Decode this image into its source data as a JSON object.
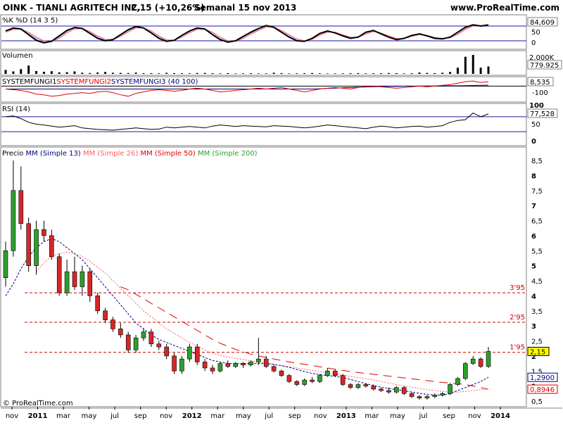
{
  "header": {
    "ticker_title": "OINK - TIANLI AGRITECH INC.",
    "price_change": "2,15 (+10,26%)",
    "period": "Semanal  15 nov 2013",
    "site": "www.ProRealTime.com"
  },
  "footer": {
    "copyright": "© ProRealTime.com"
  },
  "colors": {
    "background": "#ffffff",
    "panel_border": "#7f7f7f",
    "candle_up": "#2ca02c",
    "candle_down": "#d62728",
    "sma13": "#000080",
    "sma26": "#ff6060",
    "sma50": "#e00000",
    "hline": "#d00000",
    "reference_line": "#1a1aa0",
    "highlight_box": "#ffff00"
  },
  "x_axis": {
    "ticks": [
      "nov",
      "2011",
      "mar",
      "may",
      "jul",
      "sep",
      "nov",
      "2012",
      "mar",
      "may",
      "jul",
      "sep",
      "nov",
      "2013",
      "mar",
      "may",
      "jul",
      "sep",
      "nov",
      "2014"
    ],
    "bold_ticks": [
      "2011",
      "2012",
      "2013",
      "2014"
    ]
  },
  "chart_data": [
    {
      "type": "line",
      "name": "stochastic",
      "title": "%K %D (14 3 5)",
      "ylim": [
        0,
        100
      ],
      "y_ticks": [
        "100",
        "50",
        "0"
      ],
      "reference_levels": [
        80,
        20
      ],
      "last_value": "84,609",
      "series": [
        {
          "name": "%K",
          "values": [
            60,
            72,
            68,
            45,
            22,
            12,
            18,
            40,
            62,
            74,
            70,
            50,
            30,
            20,
            25,
            45,
            65,
            78,
            72,
            52,
            30,
            18,
            22,
            42,
            60,
            72,
            68,
            45,
            25,
            15,
            20,
            38,
            55,
            70,
            82,
            75,
            55,
            35,
            20,
            18,
            30,
            50,
            60,
            52,
            40,
            30,
            35,
            55,
            62,
            48,
            35,
            25,
            30,
            42,
            48,
            40,
            30,
            28,
            35,
            55,
            75,
            85,
            80,
            84.6
          ]
        },
        {
          "name": "%D",
          "values": [
            55,
            66,
            68,
            55,
            35,
            20,
            16,
            30,
            52,
            68,
            70,
            58,
            40,
            26,
            24,
            38,
            56,
            72,
            72,
            60,
            40,
            24,
            22,
            35,
            52,
            66,
            68,
            55,
            35,
            20,
            18,
            30,
            47,
            62,
            76,
            76,
            62,
            45,
            28,
            20,
            26,
            42,
            55,
            55,
            45,
            35,
            34,
            47,
            58,
            52,
            40,
            30,
            29,
            38,
            45,
            42,
            34,
            30,
            32,
            46,
            66,
            80,
            82,
            83
          ]
        }
      ]
    },
    {
      "type": "bar",
      "name": "volume",
      "title": "Volumen",
      "y_ticks": [
        "2.000K"
      ],
      "last_value": "779.925",
      "values": [
        420,
        260,
        500,
        880,
        300,
        220,
        280,
        160,
        180,
        260,
        120,
        90,
        140,
        200,
        120,
        100,
        90,
        130,
        80,
        70,
        60,
        110,
        80,
        70,
        60,
        90,
        100,
        70,
        60,
        80,
        50,
        60,
        70,
        55,
        60,
        120,
        80,
        50,
        60,
        70,
        90,
        60,
        50,
        55,
        60,
        70,
        80,
        60,
        65,
        70,
        90,
        80,
        60,
        70,
        140,
        100,
        80,
        120,
        200,
        650,
        1800,
        2000,
        650,
        780
      ]
    },
    {
      "type": "line",
      "name": "systemfungi",
      "title_parts": [
        "SYSTEMFUNGI1",
        "SYSTEMFUNGI2",
        "SYSTEMFUNGI3 (40 100)"
      ],
      "y_ticks": [
        "0",
        "-100"
      ],
      "last_value": "8,535",
      "series": [
        {
          "name": "SYSTEMFUNGI1",
          "values": [
            -20,
            -25,
            -30,
            -40,
            -55,
            -60,
            -70,
            -65,
            -55,
            -50,
            -45,
            -50,
            -40,
            -35,
            -45,
            -60,
            -70,
            -50,
            -40,
            -30,
            -25,
            -30,
            -35,
            -30,
            -20,
            -15,
            -20,
            -30,
            -40,
            -35,
            -30,
            -25,
            -20,
            -15,
            -20,
            -15,
            -10,
            -20,
            -30,
            -40,
            -30,
            -20,
            -15,
            -10,
            -15,
            -20,
            -10,
            -5,
            0,
            -5,
            -10,
            -15,
            -10,
            -5,
            0,
            -5,
            0,
            5,
            10,
            20,
            30,
            35,
            25,
            30
          ]
        },
        {
          "name": "SYSTEMFUNGI2",
          "values": [
            -20,
            -20,
            -20,
            -20,
            -20,
            -20,
            -20,
            -20,
            -20,
            -20,
            -20,
            -20,
            -20,
            -20,
            -20,
            -20,
            -20,
            -20,
            -20,
            -20,
            -20,
            -20,
            -20,
            -20,
            -20,
            -20,
            -20,
            -20,
            -20,
            -20,
            -20,
            -20,
            -20,
            -20,
            -20,
            -20,
            -20,
            -20,
            -20,
            -20,
            -20,
            -18,
            -16,
            -14,
            -12,
            -10,
            -8,
            -6,
            -4,
            -3,
            -2,
            -2,
            -1,
            -1,
            0,
            0,
            1,
            1,
            2,
            2,
            3,
            4,
            5,
            6
          ]
        }
      ]
    },
    {
      "type": "line",
      "name": "rsi",
      "title": "RSI (14)",
      "ylim": [
        0,
        100
      ],
      "y_ticks": [
        "100",
        "50",
        "0"
      ],
      "reference_levels": [
        70,
        30
      ],
      "last_value": "77,528",
      "values": [
        70,
        72,
        65,
        55,
        50,
        48,
        45,
        42,
        44,
        46,
        40,
        38,
        36,
        35,
        34,
        36,
        38,
        40,
        38,
        36,
        37,
        42,
        40,
        42,
        44,
        42,
        40,
        45,
        48,
        46,
        44,
        46,
        45,
        44,
        43,
        46,
        45,
        44,
        42,
        40,
        42,
        45,
        48,
        46,
        44,
        42,
        40,
        38,
        42,
        45,
        43,
        40,
        42,
        44,
        45,
        42,
        44,
        46,
        55,
        60,
        62,
        80,
        70,
        77.5
      ]
    },
    {
      "type": "bar",
      "name": "price",
      "title_parts": [
        "Precio",
        "MM (Simple 13)",
        "MM (Simple 26)",
        "MM (Simple 50)",
        "MM (Simple 200)"
      ],
      "ylim": [
        0.3,
        8.8
      ],
      "y_ticks": [
        "8,5",
        "8",
        "7,5",
        "7",
        "6,5",
        "6",
        "5,5",
        "5",
        "4,5",
        "4",
        "3,5",
        "3",
        "2,5",
        "2",
        "1,5",
        "1",
        "0,5"
      ],
      "y_values": [
        8.5,
        8,
        7.5,
        7,
        6.5,
        6,
        5.5,
        5,
        4.5,
        4,
        3.5,
        3,
        2.5,
        2,
        1.5,
        1,
        0.5
      ],
      "horizontal_levels": [
        {
          "value": 4.1,
          "label": "3'95"
        },
        {
          "value": 3.12,
          "label": "2'95"
        },
        {
          "value": 2.12,
          "label": "1'95"
        }
      ],
      "value_tags": [
        {
          "value": 2.15,
          "label": "2,15"
        },
        {
          "value": 1.29,
          "label": "1,2900"
        },
        {
          "value": 0.8946,
          "label": "0,8946"
        }
      ],
      "candles": [
        {
          "o": 4.6,
          "h": 5.8,
          "l": 4.3,
          "c": 5.5
        },
        {
          "o": 5.5,
          "h": 8.5,
          "l": 5.3,
          "c": 7.5
        },
        {
          "o": 7.5,
          "h": 8.3,
          "l": 6.2,
          "c": 6.4
        },
        {
          "o": 6.4,
          "h": 6.6,
          "l": 4.8,
          "c": 5.0
        },
        {
          "o": 5.0,
          "h": 6.5,
          "l": 4.7,
          "c": 6.2
        },
        {
          "o": 6.2,
          "h": 6.5,
          "l": 5.8,
          "c": 6.0
        },
        {
          "o": 6.0,
          "h": 6.2,
          "l": 5.2,
          "c": 5.3
        },
        {
          "o": 5.3,
          "h": 5.4,
          "l": 4.0,
          "c": 4.1
        },
        {
          "o": 4.1,
          "h": 5.2,
          "l": 4.0,
          "c": 4.8
        },
        {
          "o": 4.8,
          "h": 5.3,
          "l": 4.2,
          "c": 4.3
        },
        {
          "o": 4.3,
          "h": 5.0,
          "l": 4.0,
          "c": 4.8
        },
        {
          "o": 4.8,
          "h": 4.9,
          "l": 3.8,
          "c": 4.0
        },
        {
          "o": 4.0,
          "h": 4.1,
          "l": 3.4,
          "c": 3.5
        },
        {
          "o": 3.5,
          "h": 3.6,
          "l": 3.1,
          "c": 3.2
        },
        {
          "o": 3.2,
          "h": 3.3,
          "l": 2.8,
          "c": 2.9
        },
        {
          "o": 2.9,
          "h": 3.1,
          "l": 2.6,
          "c": 2.7
        },
        {
          "o": 2.7,
          "h": 2.8,
          "l": 2.1,
          "c": 2.2
        },
        {
          "o": 2.2,
          "h": 2.7,
          "l": 2.1,
          "c": 2.6
        },
        {
          "o": 2.6,
          "h": 2.9,
          "l": 2.5,
          "c": 2.8
        },
        {
          "o": 2.8,
          "h": 2.9,
          "l": 2.3,
          "c": 2.4
        },
        {
          "o": 2.4,
          "h": 2.5,
          "l": 2.2,
          "c": 2.3
        },
        {
          "o": 2.3,
          "h": 2.4,
          "l": 1.9,
          "c": 2.0
        },
        {
          "o": 2.0,
          "h": 2.1,
          "l": 1.4,
          "c": 1.5
        },
        {
          "o": 1.5,
          "h": 2.0,
          "l": 1.4,
          "c": 1.9
        },
        {
          "o": 1.9,
          "h": 2.4,
          "l": 1.8,
          "c": 2.3
        },
        {
          "o": 2.3,
          "h": 2.4,
          "l": 1.7,
          "c": 1.8
        },
        {
          "o": 1.8,
          "h": 1.9,
          "l": 1.5,
          "c": 1.6
        },
        {
          "o": 1.6,
          "h": 1.7,
          "l": 1.4,
          "c": 1.5
        },
        {
          "o": 1.5,
          "h": 1.8,
          "l": 1.45,
          "c": 1.75
        },
        {
          "o": 1.75,
          "h": 1.85,
          "l": 1.6,
          "c": 1.65
        },
        {
          "o": 1.65,
          "h": 1.8,
          "l": 1.6,
          "c": 1.75
        },
        {
          "o": 1.75,
          "h": 1.8,
          "l": 1.6,
          "c": 1.7
        },
        {
          "o": 1.7,
          "h": 1.85,
          "l": 1.65,
          "c": 1.8
        },
        {
          "o": 1.8,
          "h": 2.6,
          "l": 1.7,
          "c": 1.9
        },
        {
          "o": 1.9,
          "h": 2.0,
          "l": 1.6,
          "c": 1.65
        },
        {
          "o": 1.65,
          "h": 1.7,
          "l": 1.45,
          "c": 1.5
        },
        {
          "o": 1.5,
          "h": 1.55,
          "l": 1.3,
          "c": 1.35
        },
        {
          "o": 1.35,
          "h": 1.4,
          "l": 1.1,
          "c": 1.15
        },
        {
          "o": 1.15,
          "h": 1.2,
          "l": 1.0,
          "c": 1.05
        },
        {
          "o": 1.05,
          "h": 1.25,
          "l": 1.0,
          "c": 1.2
        },
        {
          "o": 1.2,
          "h": 1.3,
          "l": 1.1,
          "c": 1.15
        },
        {
          "o": 1.15,
          "h": 1.4,
          "l": 1.1,
          "c": 1.35
        },
        {
          "o": 1.35,
          "h": 1.6,
          "l": 1.3,
          "c": 1.5
        },
        {
          "o": 1.5,
          "h": 1.55,
          "l": 1.3,
          "c": 1.35
        },
        {
          "o": 1.35,
          "h": 1.4,
          "l": 1.0,
          "c": 1.05
        },
        {
          "o": 1.05,
          "h": 1.1,
          "l": 0.9,
          "c": 0.95
        },
        {
          "o": 0.95,
          "h": 1.1,
          "l": 0.9,
          "c": 1.05
        },
        {
          "o": 1.05,
          "h": 1.1,
          "l": 0.95,
          "c": 1.0
        },
        {
          "o": 1.0,
          "h": 1.05,
          "l": 0.85,
          "c": 0.9
        },
        {
          "o": 0.9,
          "h": 0.95,
          "l": 0.8,
          "c": 0.85
        },
        {
          "o": 0.85,
          "h": 0.95,
          "l": 0.75,
          "c": 0.8
        },
        {
          "o": 0.8,
          "h": 1.0,
          "l": 0.75,
          "c": 0.95
        },
        {
          "o": 0.95,
          "h": 1.0,
          "l": 0.7,
          "c": 0.75
        },
        {
          "o": 0.75,
          "h": 0.8,
          "l": 0.6,
          "c": 0.65
        },
        {
          "o": 0.65,
          "h": 0.7,
          "l": 0.55,
          "c": 0.6
        },
        {
          "o": 0.6,
          "h": 0.7,
          "l": 0.55,
          "c": 0.65
        },
        {
          "o": 0.65,
          "h": 0.75,
          "l": 0.6,
          "c": 0.7
        },
        {
          "o": 0.7,
          "h": 0.8,
          "l": 0.65,
          "c": 0.75
        },
        {
          "o": 0.75,
          "h": 1.1,
          "l": 0.7,
          "c": 1.05
        },
        {
          "o": 1.05,
          "h": 1.3,
          "l": 1.0,
          "c": 1.25
        },
        {
          "o": 1.25,
          "h": 1.8,
          "l": 1.2,
          "c": 1.75
        },
        {
          "o": 1.75,
          "h": 2.0,
          "l": 1.7,
          "c": 1.9
        },
        {
          "o": 1.9,
          "h": 1.95,
          "l": 1.6,
          "c": 1.65
        },
        {
          "o": 1.65,
          "h": 2.3,
          "l": 1.6,
          "c": 2.15
        }
      ],
      "sma13_values": [
        4.0,
        4.4,
        4.9,
        5.3,
        5.6,
        5.8,
        5.9,
        5.8,
        5.6,
        5.4,
        5.2,
        4.9,
        4.6,
        4.3,
        4.0,
        3.7,
        3.4,
        3.1,
        2.9,
        2.7,
        2.55,
        2.45,
        2.35,
        2.25,
        2.15,
        2.05,
        1.95,
        1.85,
        1.8,
        1.75,
        1.75,
        1.75,
        1.75,
        1.75,
        1.75,
        1.72,
        1.68,
        1.62,
        1.55,
        1.48,
        1.42,
        1.38,
        1.35,
        1.32,
        1.28,
        1.22,
        1.15,
        1.08,
        1.02,
        0.96,
        0.92,
        0.88,
        0.85,
        0.8,
        0.76,
        0.72,
        0.7,
        0.7,
        0.75,
        0.85,
        0.95,
        1.05,
        1.15,
        1.29
      ],
      "sma26_values": [
        null,
        null,
        null,
        null,
        4.8,
        5.1,
        5.3,
        5.4,
        5.45,
        5.4,
        5.3,
        5.15,
        4.95,
        4.75,
        4.5,
        4.25,
        4.0,
        3.75,
        3.5,
        3.3,
        3.1,
        2.9,
        2.75,
        2.6,
        2.45,
        2.32,
        2.2,
        2.1,
        2.02,
        1.96,
        1.92,
        1.88,
        1.84,
        1.8,
        1.76,
        1.72,
        1.68,
        1.64,
        1.6,
        1.56,
        1.52,
        1.48,
        1.44,
        1.4,
        1.36,
        1.32,
        1.28,
        1.24,
        1.2,
        1.15,
        1.1,
        1.05,
        1.0,
        0.96,
        0.92,
        0.88,
        0.85,
        0.82,
        0.8,
        0.8,
        0.82,
        0.85,
        0.88,
        0.9
      ],
      "sma50_values": [
        null,
        null,
        null,
        null,
        null,
        null,
        null,
        null,
        null,
        null,
        null,
        null,
        null,
        null,
        null,
        4.3,
        4.2,
        4.05,
        3.9,
        3.75,
        3.6,
        3.45,
        3.3,
        3.15,
        3.0,
        2.85,
        2.7,
        2.55,
        2.42,
        2.32,
        2.22,
        2.14,
        2.06,
        2.0,
        1.95,
        1.9,
        1.85,
        1.8,
        1.76,
        1.72,
        1.68,
        1.64,
        1.6,
        1.56,
        1.52,
        1.48,
        1.45,
        1.42,
        1.39,
        1.36,
        1.33,
        1.3,
        1.27,
        1.24,
        1.21,
        1.18,
        1.15,
        1.12,
        1.1,
        1.08,
        1.05,
        1.0,
        0.95,
        0.89
      ]
    }
  ]
}
